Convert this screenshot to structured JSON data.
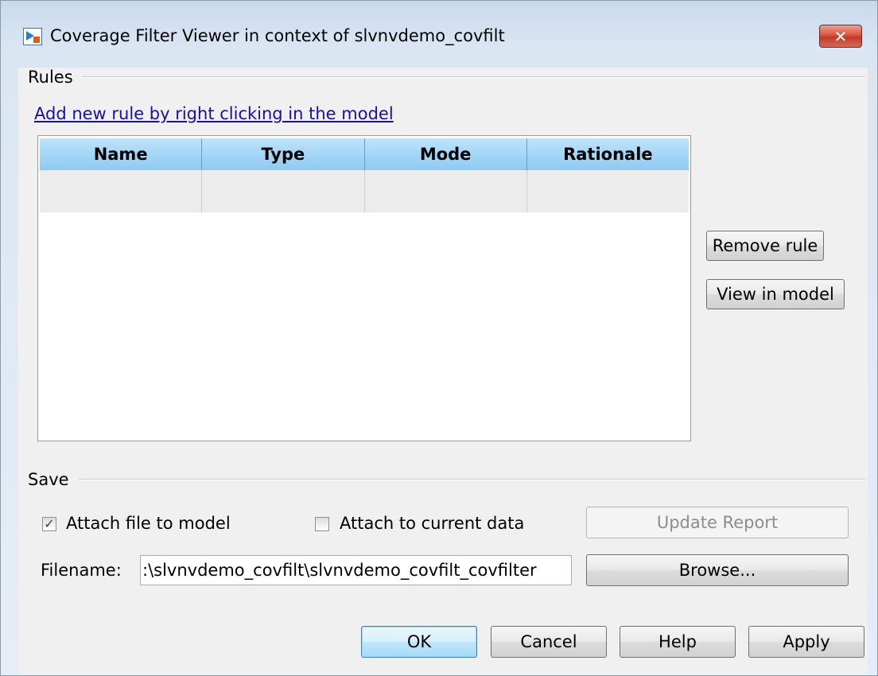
{
  "window": {
    "title": "Coverage Filter Viewer in context of slvnvdemo_covfilt",
    "close_label": "✕"
  },
  "rules": {
    "group_label": "Rules",
    "add_link": "Add new rule by right clicking in the model",
    "table": {
      "columns": [
        "Name",
        "Type",
        "Mode",
        "Rationale"
      ],
      "rows": [
        [
          "",
          "",
          "",
          ""
        ]
      ]
    },
    "remove_rule_label": "Remove rule",
    "view_in_model_label": "View in model"
  },
  "save": {
    "group_label": "Save",
    "attach_file": {
      "label": "Attach file to model",
      "checked": true
    },
    "attach_current": {
      "label": "Attach to current data",
      "checked": false
    },
    "update_report_label": "Update Report",
    "filename_label": "Filename:",
    "filename_value": ":\\slvnvdemo_covfilt\\slvnvdemo_covfilt_covfilter",
    "browse_label": "Browse..."
  },
  "footer": {
    "ok_label": "OK",
    "cancel_label": "Cancel",
    "help_label": "Help",
    "apply_label": "Apply"
  },
  "icons": {
    "app": "simulink-app-icon",
    "close": "close-icon",
    "check": "checkmark-icon"
  }
}
